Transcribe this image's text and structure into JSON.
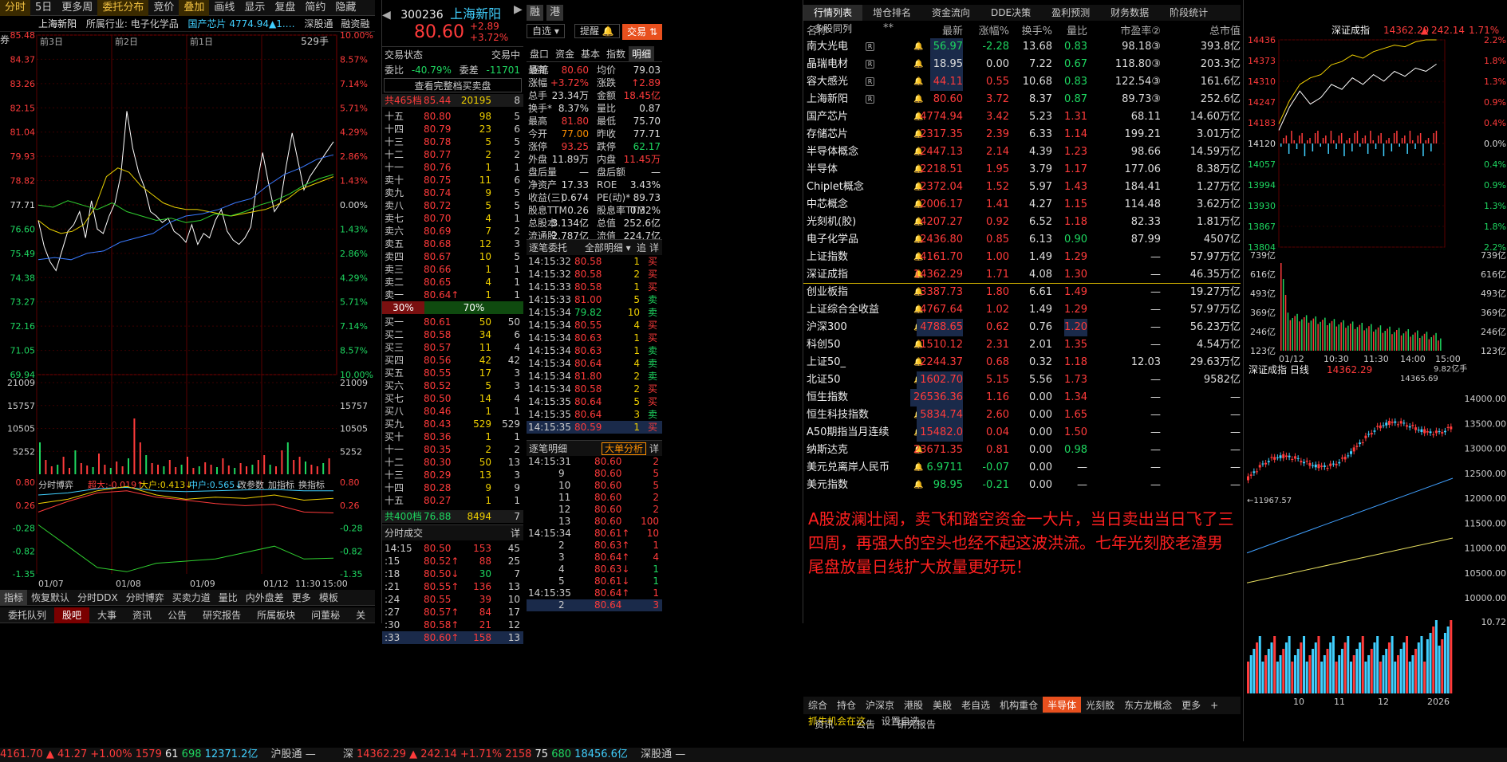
{
  "top_toolbar": [
    "分时",
    "5日",
    "更多周",
    "委托分布",
    "竞价",
    "叠加",
    "画线",
    "显示",
    "复盘",
    "简约",
    "隐藏"
  ],
  "left": {
    "stock_name": "上海新阳",
    "industry_label": "所属行业: 电子化学品",
    "concept": "国产芯片 4774.94▲1.…",
    "shenhk": "深股通",
    "margin": "融资融券",
    "days": [
      "前3日",
      "前2日",
      "前1日"
    ],
    "vol_label": "529手",
    "price_ticks": [
      "85.48",
      "84.37",
      "83.26",
      "82.15",
      "81.04",
      "79.93",
      "78.82",
      "77.71",
      "76.60",
      "75.49",
      "74.38",
      "73.27",
      "72.16",
      "71.05",
      "69.94"
    ],
    "pct_ticks": [
      "10.00%",
      "8.57%",
      "7.14%",
      "5.71%",
      "4.29%",
      "2.86%",
      "1.43%",
      "0.00%",
      "1.43%",
      "2.86%",
      "4.29%",
      "5.71%",
      "7.14%",
      "8.57%",
      "10.00%"
    ],
    "vol_ticks": [
      "21009",
      "15757",
      "10505",
      "5252"
    ],
    "ind_ticks": [
      "0.80",
      "0.26",
      "-0.28",
      "-0.82",
      "-1.35"
    ],
    "time_ticks": [
      "01/07",
      "01/08",
      "01/09",
      "01/12",
      "11:30",
      "15:00"
    ],
    "indicator": {
      "name": "分时博弈",
      "super": "超大:-0.019↑",
      "big": "大户:0.413↓",
      "mid": "中户:0.565↓",
      "p1": "改参数",
      "p2": "加指标",
      "p3": "换指标"
    },
    "bottom_tabs": [
      "指标",
      "恢复默认",
      "分时DDX",
      "分时博弈",
      "买卖力道",
      "量比",
      "内外盘差",
      "更多",
      "模板"
    ],
    "nav_tabs": [
      "委托队列",
      "股吧",
      "大事",
      "资讯",
      "公告",
      "研究报告",
      "所属板块",
      "问董秘",
      "关"
    ]
  },
  "quote": {
    "code": "300236",
    "name": "上海新阳",
    "price": "80.60",
    "chg": "+2.89",
    "pct": "+3.72%",
    "tag1": "融",
    "tag2": "港",
    "btn_zixuan": "自选",
    "btn_tixing": "提醒",
    "btn_jiaoyi": "交易",
    "status_label": "交易状态",
    "status_val": "交易中",
    "weibi_label": "委比",
    "weibi_val": "-40.79%",
    "weicha_label": "委差",
    "weicha_val": "-11701",
    "full_btn": "查看完整档买卖盘",
    "sell_total": {
      "label": "共465档",
      "price": "85.44",
      "vol": "20195",
      "n": "8"
    },
    "sells": [
      [
        "十五",
        "80.80",
        "98",
        "5"
      ],
      [
        "十四",
        "80.79",
        "23",
        "6"
      ],
      [
        "十三",
        "80.78",
        "5",
        "5"
      ],
      [
        "十二",
        "80.77",
        "2",
        "2"
      ],
      [
        "十一",
        "80.76",
        "1",
        "1"
      ],
      [
        "卖十",
        "80.75",
        "11",
        "6"
      ],
      [
        "卖九",
        "80.74",
        "9",
        "5"
      ],
      [
        "卖八",
        "80.72",
        "5",
        "5"
      ],
      [
        "卖七",
        "80.70",
        "4",
        "1"
      ],
      [
        "卖六",
        "80.69",
        "7",
        "2"
      ],
      [
        "卖五",
        "80.68",
        "12",
        "3"
      ],
      [
        "卖四",
        "80.67",
        "10",
        "5"
      ],
      [
        "卖三",
        "80.66",
        "1",
        "1"
      ],
      [
        "卖二",
        "80.65",
        "4",
        "1"
      ],
      [
        "卖一",
        "80.64↑",
        "1",
        "1"
      ]
    ],
    "ratio": [
      "30%",
      "70%"
    ],
    "buys": [
      [
        "买一",
        "80.61",
        "50",
        "50"
      ],
      [
        "买二",
        "80.58",
        "34",
        "6"
      ],
      [
        "买三",
        "80.57",
        "11",
        "4"
      ],
      [
        "买四",
        "80.56",
        "42",
        "42"
      ],
      [
        "买五",
        "80.55",
        "17",
        "3"
      ],
      [
        "买六",
        "80.52",
        "5",
        "3"
      ],
      [
        "买七",
        "80.50",
        "14",
        "4"
      ],
      [
        "买八",
        "80.46",
        "1",
        "1"
      ],
      [
        "买九",
        "80.43",
        "529",
        "529"
      ],
      [
        "买十",
        "80.36",
        "1",
        "1"
      ],
      [
        "十一",
        "80.35",
        "2",
        "2"
      ],
      [
        "十二",
        "80.30",
        "50",
        "13"
      ],
      [
        "十三",
        "80.29",
        "13",
        "3"
      ],
      [
        "十四",
        "80.28",
        "9",
        "9"
      ],
      [
        "十五",
        "80.27",
        "1",
        "1"
      ]
    ],
    "buy_total": {
      "label": "共400档",
      "price": "76.88",
      "vol": "8494",
      "n": "7"
    },
    "trade_title": "分时成交",
    "detail": "详",
    "trades": [
      [
        "14:15",
        "80.50",
        "153",
        "45"
      ],
      [
        ":15",
        "80.52↑",
        "88",
        "25"
      ],
      [
        ":18",
        "80.50↓",
        "30",
        "7"
      ],
      [
        ":21",
        "80.55↑",
        "136",
        "13"
      ],
      [
        ":24",
        "80.55",
        "39",
        "10"
      ],
      [
        ":27",
        "80.57↑",
        "84",
        "17"
      ],
      [
        ":30",
        "80.58↑",
        "21",
        "12"
      ],
      [
        ":33",
        "80.60↑",
        "158",
        "13"
      ]
    ]
  },
  "mid": {
    "tabs": [
      "盘口",
      "资金",
      "基本",
      "指数",
      "明细",
      "逐笔"
    ],
    "stats": [
      [
        "最新",
        "80.60",
        "均价",
        "79.03"
      ],
      [
        "涨幅",
        "+3.72%",
        "涨跌",
        "↑2.89"
      ],
      [
        "总手",
        "23.34万",
        "金额",
        "18.45亿"
      ],
      [
        "换手*",
        "8.37%",
        "量比",
        "0.87"
      ],
      [
        "最高",
        "81.80",
        "最低",
        "75.70"
      ],
      [
        "今开",
        "77.00",
        "昨收",
        "77.71"
      ],
      [
        "涨停",
        "93.25",
        "跌停",
        "62.17"
      ],
      [
        "外盘",
        "11.89万",
        "内盘",
        "11.45万"
      ],
      [
        "盘后量",
        "—",
        "盘后额",
        "—"
      ],
      [
        "净资产",
        "17.33",
        "ROE",
        "3.43%"
      ],
      [
        "收益(三)",
        "0.674",
        "PE(动)*",
        "89.73"
      ],
      [
        "股息TTM",
        "0.26",
        "股息率TTM",
        "0.32%"
      ],
      [
        "总股本",
        "3.134亿",
        "总值",
        "252.6亿"
      ],
      [
        "流通股",
        "2.787亿",
        "流值",
        "224.7亿"
      ]
    ],
    "zhubi_title": "逐笔委托",
    "zhubi_sel": "全部明细",
    "zhubi_btn1": "追",
    "zhubi_btn2": "详",
    "zhubi": [
      [
        "14:15:32",
        "80.58",
        "1",
        "买"
      ],
      [
        "14:15:32",
        "80.58",
        "2",
        "买"
      ],
      [
        "14:15:33",
        "80.58",
        "1",
        "买"
      ],
      [
        "14:15:33",
        "81.00",
        "5",
        "卖"
      ],
      [
        "14:15:34",
        "79.82",
        "10",
        "卖"
      ],
      [
        "14:15:34",
        "80.55",
        "4",
        "买"
      ],
      [
        "14:15:34",
        "80.63",
        "1",
        "买"
      ],
      [
        "14:15:34",
        "80.63",
        "1",
        "卖"
      ],
      [
        "14:15:34",
        "80.64",
        "4",
        "卖"
      ],
      [
        "14:15:34",
        "81.80",
        "2",
        "卖"
      ],
      [
        "14:15:34",
        "80.58",
        "2",
        "买"
      ],
      [
        "14:15:35",
        "80.64",
        "5",
        "买"
      ],
      [
        "14:15:35",
        "80.64",
        "3",
        "卖"
      ],
      [
        "14:15:35",
        "80.59",
        "1",
        "买"
      ]
    ],
    "mingxi_title": "逐笔明细",
    "mingxi_btn": "大单分析",
    "mingxi_detail": "详",
    "mingxi": [
      [
        "14:15:31",
        "80.60",
        "2"
      ],
      [
        "9",
        "80.60",
        "5"
      ],
      [
        "10",
        "80.60",
        "5"
      ],
      [
        "11",
        "80.60",
        "2"
      ],
      [
        "12",
        "80.60",
        "2"
      ],
      [
        "13",
        "80.60",
        "100"
      ],
      [
        "14:15:34",
        "80.61↑",
        "10"
      ],
      [
        "2",
        "80.63↑",
        "1"
      ],
      [
        "3",
        "80.64↑",
        "4"
      ],
      [
        "4",
        "80.63↓",
        "1"
      ],
      [
        "5",
        "80.61↓",
        "1"
      ],
      [
        "14:15:35",
        "80.64↑",
        "1"
      ],
      [
        "2",
        "80.64",
        "3"
      ]
    ]
  },
  "table": {
    "tabs": [
      "行情列表",
      "增仓排名",
      "资金流向",
      "DDE决策",
      "盈利预测",
      "财务数据",
      "阶段统计",
      "多股同列"
    ],
    "headers": [
      "名称",
      "**",
      "最新",
      "涨幅%",
      "换手%",
      "量比",
      "市盈率②",
      "总市值"
    ],
    "rows": [
      [
        "南大光电",
        "R",
        "56.97",
        "-2.28",
        "13.68",
        "0.83",
        "98.18③",
        "393.8亿"
      ],
      [
        "晶瑞电材",
        "R",
        "18.95",
        "0.00",
        "7.22",
        "0.67",
        "118.80③",
        "203.3亿"
      ],
      [
        "容大感光",
        "R",
        "44.11",
        "0.55",
        "10.68",
        "0.83",
        "122.54③",
        "161.6亿"
      ],
      [
        "上海新阳",
        "R",
        "80.60",
        "3.72",
        "8.37",
        "0.87",
        "89.73③",
        "252.6亿"
      ],
      [
        "国产芯片",
        "",
        "4774.94",
        "3.42",
        "5.23",
        "1.31",
        "68.11",
        "14.60万亿"
      ],
      [
        "存储芯片",
        "",
        "2317.35",
        "2.39",
        "6.33",
        "1.14",
        "199.21",
        "3.01万亿"
      ],
      [
        "半导体概念",
        "",
        "2447.13",
        "2.14",
        "4.39",
        "1.23",
        "98.66",
        "14.59万亿"
      ],
      [
        "半导体",
        "",
        "2218.51",
        "1.95",
        "3.79",
        "1.17",
        "177.06",
        "8.38万亿"
      ],
      [
        "Chiplet概念",
        "",
        "2372.04",
        "1.52",
        "5.97",
        "1.43",
        "184.41",
        "1.27万亿"
      ],
      [
        "中芯概念",
        "",
        "2006.17",
        "1.41",
        "4.27",
        "1.15",
        "114.48",
        "3.62万亿"
      ],
      [
        "光刻机(胶)",
        "",
        "4207.27",
        "0.92",
        "6.52",
        "1.18",
        "82.33",
        "1.81万亿"
      ],
      [
        "电子化学品",
        "",
        "2436.80",
        "0.85",
        "6.13",
        "0.90",
        "87.99",
        "4507亿"
      ],
      [
        "上证指数",
        "",
        "4161.70",
        "1.00",
        "1.49",
        "1.29",
        "—",
        "57.97万亿"
      ],
      [
        "深证成指",
        "",
        "14362.29",
        "1.71",
        "4.08",
        "1.30",
        "—",
        "46.35万亿"
      ],
      [
        "创业板指",
        "",
        "3387.73",
        "1.80",
        "6.61",
        "1.49",
        "—",
        "19.27万亿"
      ],
      [
        "上证综合全收益",
        "",
        "4767.64",
        "1.02",
        "1.49",
        "1.29",
        "—",
        "57.97万亿"
      ],
      [
        "沪深300",
        "",
        "4788.65",
        "0.62",
        "0.76",
        "1.20",
        "—",
        "56.23万亿"
      ],
      [
        "科创50",
        "",
        "1510.12",
        "2.31",
        "2.01",
        "1.35",
        "—",
        "4.54万亿"
      ],
      [
        "上证50_",
        "",
        "2244.37",
        "0.68",
        "0.32",
        "1.18",
        "12.03",
        "29.63万亿"
      ],
      [
        "北证50",
        "",
        "1602.70",
        "5.15",
        "5.56",
        "1.73",
        "—",
        "9582亿"
      ],
      [
        "恒生指数",
        "",
        "26536.36",
        "1.16",
        "0.00",
        "1.34",
        "—",
        "—"
      ],
      [
        "恒生科技指数",
        "",
        "5834.74",
        "2.60",
        "0.00",
        "1.65",
        "—",
        "—"
      ],
      [
        "A50期指当月连续",
        "",
        "15482.0",
        "0.04",
        "0.00",
        "1.50",
        "—",
        "—"
      ],
      [
        "纳斯达克",
        "",
        "23671.35",
        "0.81",
        "0.00",
        "0.98",
        "—",
        "—"
      ],
      [
        "美元兑离岸人民币",
        "",
        "6.9711",
        "-0.07",
        "0.00",
        "—",
        "—",
        "—"
      ],
      [
        "美元指数",
        "",
        "98.95",
        "-0.21",
        "0.00",
        "—",
        "—",
        "—"
      ]
    ],
    "comment": "A股波澜壮阔，卖飞和踏空资金一大片，当日卖出当日飞了三四周，再强大的空头也经不起这波洪流。七年光刻胶老渣男尾盘放量日线扩大放量更好玩！",
    "bottom_tabs": [
      "综合",
      "持仓",
      "沪深京",
      "港股",
      "美股",
      "老自选",
      "机构重仓",
      "半导体",
      "光刻胶",
      "东方龙概念",
      "更多",
      "+",
      "抓牛机会在这..",
      "设置自选"
    ],
    "sub_tabs": [
      "资讯",
      "公告",
      "研究报告"
    ]
  },
  "right": {
    "title": "深证成指",
    "price": "14362.29",
    "chg": "▲ 242.14",
    "pct": "1.71%",
    "y_ticks": [
      "14436",
      "14373",
      "14310",
      "14247",
      "14183",
      "14120",
      "14057",
      "13994",
      "13930",
      "13867",
      "13804"
    ],
    "pct_ticks": [
      "2.2%",
      "1.8%",
      "1.3%",
      "0.9%",
      "0.4%",
      "0.0%",
      "0.4%",
      "0.9%",
      "1.3%",
      "1.8%",
      "2.2%"
    ],
    "vol_ticks": [
      "739亿",
      "616亿",
      "493亿",
      "369亿",
      "246亿",
      "123亿"
    ],
    "time_ticks": [
      "01/12",
      "10:30",
      "11:30",
      "14:00",
      "15:00"
    ],
    "k_title": "深证成指 日线",
    "k_price": "14362.29",
    "k_max": "9.82亿手",
    "k_high": "14365.69",
    "k_ticks": [
      "14000.00",
      "13500.00",
      "13000.00",
      "12500.00",
      "12000.00",
      "11500.00",
      "11000.00",
      "10500.00",
      "10000.00"
    ],
    "k_low": "11967.57",
    "k_vol": "10.72",
    "k_months": [
      "10",
      "11",
      "12",
      "2026"
    ]
  },
  "status": {
    "sh": "4161.70",
    "sh_chg": "▲ 41.27",
    "sh_pct": "+1.00%",
    "sh_up": "1579",
    "sh_flat": "61",
    "sh_down": "698",
    "sh_amt": "12371.2亿",
    "hgt": "沪股通",
    "hgt_v": "—",
    "sz_label": "深",
    "sz": "14362.29",
    "sz_chg": "▲ 242.14",
    "sz_pct": "+1.71%",
    "sz_up": "2158",
    "sz_flat": "75",
    "sz_down": "680",
    "sz_amt": "18456.6亿",
    "sgt": "深股通",
    "sgt_v": "—"
  }
}
